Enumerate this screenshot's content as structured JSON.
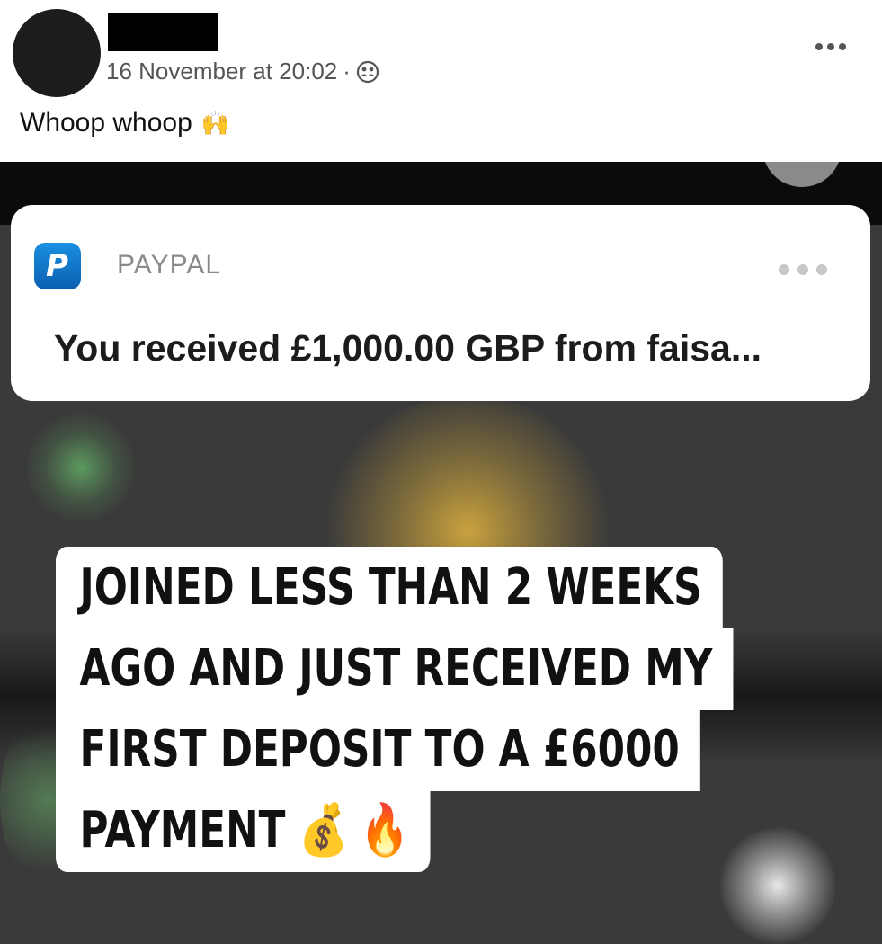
{
  "post": {
    "timestamp": "16 November at 20:02",
    "separator": "·",
    "privacy_icon": "friends-icon",
    "caption_text": "Whoop whoop",
    "caption_emoji": "🙌"
  },
  "notification": {
    "app_name": "PAYPAL",
    "message": "You received £1,000.00 GBP from faisa..."
  },
  "overlay_caption": {
    "lines": [
      "JOINED LESS THAN 2 WEEKS",
      "AGO AND JUST RECEIVED MY",
      "FIRST DEPOSIT TO A £6000",
      "PAYMENT"
    ],
    "emojis": "💰 🔥"
  },
  "colors": {
    "paypal_blue": "#0b5fb0",
    "photo_background": "#3a3a3a"
  }
}
